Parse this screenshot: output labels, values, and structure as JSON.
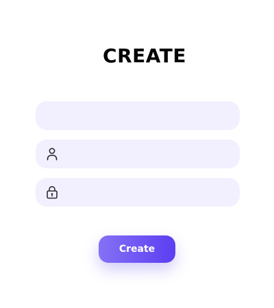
{
  "form": {
    "title": "CREATE",
    "fields": [
      {
        "icon": "",
        "value": "",
        "placeholder": ""
      },
      {
        "icon": "user-icon",
        "value": "",
        "placeholder": ""
      },
      {
        "icon": "lock-icon",
        "value": "",
        "placeholder": ""
      }
    ],
    "submit_label": "Create"
  },
  "colors": {
    "background": "#ffffff",
    "field_background": "#f2f0fe",
    "title": "#050505",
    "button_gradient_start": "#8471f5",
    "button_gradient_end": "#5c3ef2",
    "button_text": "#ffffff",
    "icon": "#2b2b33"
  }
}
